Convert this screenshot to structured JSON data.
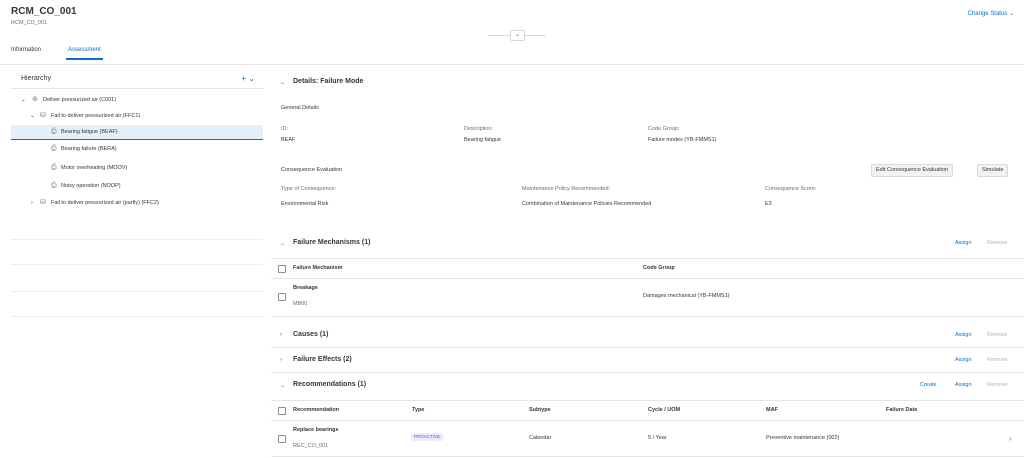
{
  "header": {
    "title": "RCM_CO_001",
    "subtitle": "RCM_CO_001",
    "change_status": "Change Status ⌄"
  },
  "tabs": [
    {
      "label": "Information",
      "active": false
    },
    {
      "label": "Assessment",
      "active": true
    }
  ],
  "hierarchy": {
    "title": "Hierarchy",
    "add_label": "+ ⌄",
    "items": [
      {
        "label": "Deliver pressurized air (C001)"
      },
      {
        "label": "Fail to deliver pressurized air (FFC1)"
      },
      {
        "label": "Bearing fatigue (BEAF)"
      },
      {
        "label": "Bearing failure (BERA)"
      },
      {
        "label": "Motor overheating (MOOV)"
      },
      {
        "label": "Noisy operation (NOOP)"
      },
      {
        "label": "Fail to deliver pressurized air (partly) (FFC2)"
      }
    ]
  },
  "details": {
    "title": "Details: Failure Mode",
    "general_title": "General Details",
    "fields": [
      {
        "label": "ID:",
        "value": "BEAF"
      },
      {
        "label": "Description:",
        "value": "Bearing fatigue"
      },
      {
        "label": "Code Group:",
        "value": "Failure modes (YB-FMMS1)"
      }
    ],
    "consequence_title": "Consequence Evaluation",
    "edit_button": "Edit Consequence Evaluation",
    "simulate_button": "Simulate",
    "consequence_fields": [
      {
        "label": "Type of Consequence:",
        "value": "Environmental Risk"
      },
      {
        "label": "Maintenance Policy Recommended:",
        "value": "Combination of Maintenance Policies Recommended"
      },
      {
        "label": "Consequence Score:",
        "value": "E3"
      }
    ]
  },
  "failure_mechanisms": {
    "title": "Failure Mechanisms (1)",
    "assign": "Assign",
    "remove": "Remove",
    "columns": [
      "Failure Mechanism",
      "Code Group"
    ],
    "rows": [
      {
        "name": "Breakage",
        "id": "MB00",
        "code_group": "Damages mechanical (YB-FMMS1)"
      }
    ]
  },
  "causes": {
    "title": "Causes (1)",
    "assign": "Assign",
    "remove": "Remove"
  },
  "failure_effects": {
    "title": "Failure Effects (2)",
    "assign": "Assign",
    "remove": "Remove"
  },
  "recommendations": {
    "title": "Recommendations (1)",
    "create": "Create",
    "assign": "Assign",
    "remove": "Remove",
    "columns": [
      "Recommendation",
      "Type",
      "Subtype",
      "Cycle / UOM",
      "MAF",
      "Failure Date"
    ],
    "rows": [
      {
        "name": "Replace bearings",
        "id": "REC_CO_001",
        "type": "PROACTIVE",
        "subtype": "Calendar",
        "cycle": "5 / Year",
        "maf": "Preventive maintenance (002)",
        "failure_date": ""
      }
    ]
  },
  "colors": {
    "accent": "#0a6ed1",
    "selected_bg": "#e5f0fa"
  }
}
